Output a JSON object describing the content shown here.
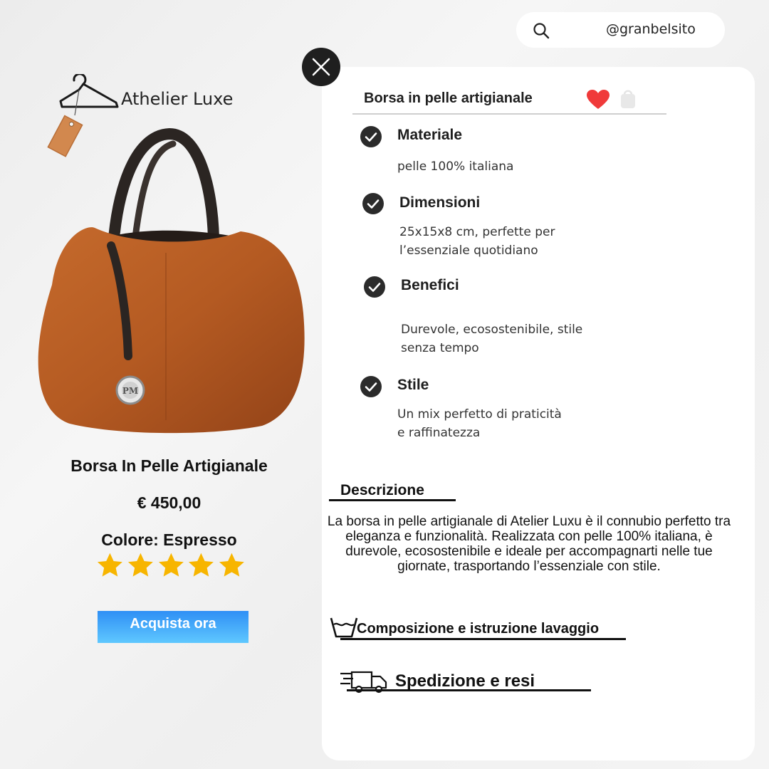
{
  "header": {
    "handle": "@granbelsito",
    "search_icon": "search-icon"
  },
  "brand": {
    "name": "Athelier Luxe",
    "icon": "hanger-icon"
  },
  "product": {
    "name": "Borsa In Pelle Artigianale",
    "price": "€ 450,00",
    "color_label": "Colore: Espresso",
    "rating": 5,
    "rating_max": 5,
    "buy_label": "Acquista ora",
    "badge_text": "PM"
  },
  "panel": {
    "title": "Borsa in pelle artigianale",
    "features": [
      {
        "title": "Materiale",
        "text": "pelle 100% italiana"
      },
      {
        "title": "Dimensioni",
        "text": "25x15x8 cm, perfette per l’essenziale quotidiano"
      },
      {
        "title": "Benefici",
        "text": "Durevole, ecosostenibile, stile senza tempo"
      },
      {
        "title": "Stile",
        "text": "Un mix perfetto di praticità e raffinatezza"
      }
    ],
    "description_heading": "Descrizione",
    "description": "La borsa in pelle artigianale di Atelier Luxu è il connubio perfetto tra eleganza e funzionalità. Realizzata con pelle 100% italiana, è durevole, ecosostenibile e ideale per accompagnarti nelle tue giornate, trasportando l’essenziale con stile.",
    "care_label": "Composizione e istruzione lavaggio",
    "shipping_label": "Spedizione e resi"
  },
  "colors": {
    "accent_button": "#2f8ff5",
    "star": "#f7b500",
    "heart": "#f03a3a",
    "leather": "#b55a22"
  }
}
